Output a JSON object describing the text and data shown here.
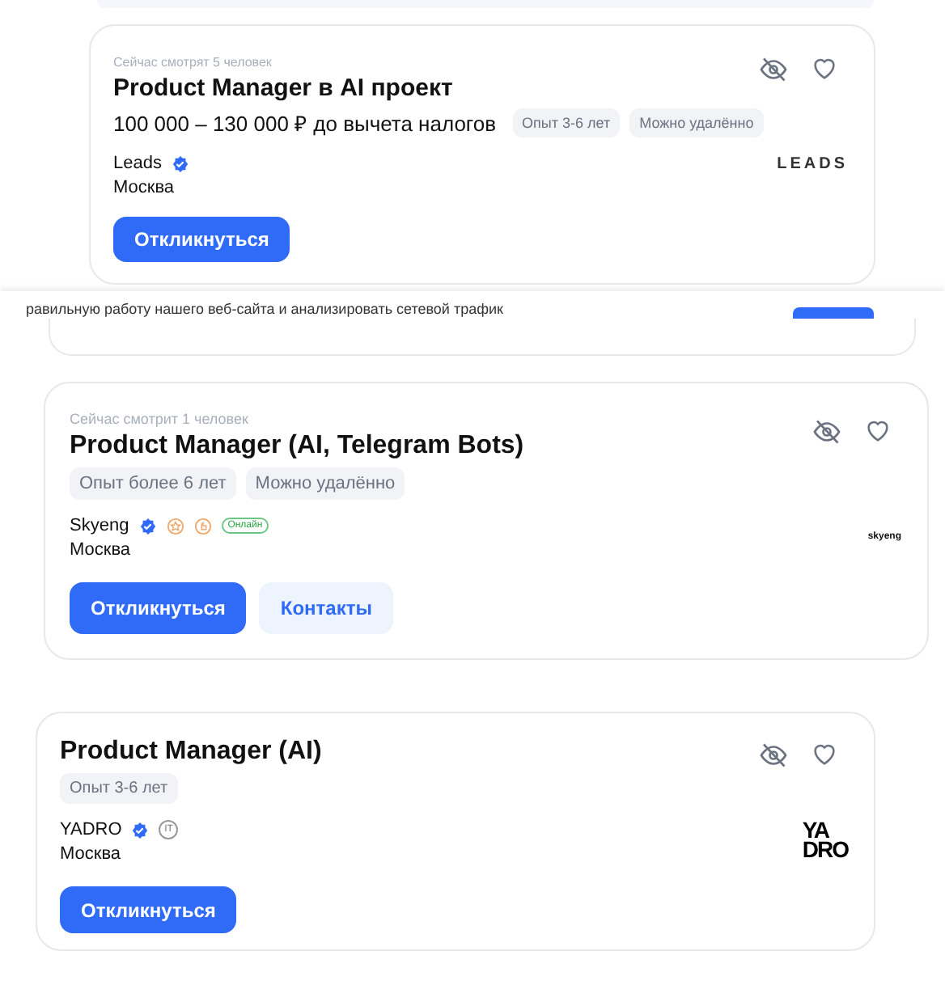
{
  "cards": [
    {
      "viewers": "Сейчас смотрят 5 человек",
      "title": "Product Manager в AI проект",
      "salary": "100 000 – 130 000 ₽ до вычета налогов",
      "tags": [
        "Опыт 3-6 лет",
        "Можно удалённо"
      ],
      "company": "Leads",
      "verified": true,
      "city": "Москва",
      "logo": {
        "kind": "wordmark",
        "lines": [
          "LEADS"
        ]
      },
      "buttons": [
        {
          "label": "Откликнуться",
          "kind": "primary"
        }
      ]
    },
    {
      "viewers": "Сейчас смотрит 1 человек",
      "title": "Product Manager (AI, Telegram Bots)",
      "tags": [
        "Опыт более 6 лет",
        "Можно удалённо"
      ],
      "company": "Skyeng",
      "verified": true,
      "badges": [
        {
          "kind": "award"
        },
        {
          "kind": "hand"
        },
        {
          "kind": "status",
          "label": "Онлайн"
        }
      ],
      "city": "Москва",
      "logo": {
        "kind": "small",
        "lines": [
          "skyeng"
        ]
      },
      "buttons": [
        {
          "label": "Откликнуться",
          "kind": "primary"
        },
        {
          "label": "Контакты",
          "kind": "secondary"
        }
      ]
    },
    {
      "title": "Product Manager (AI)",
      "tags": [
        "Опыт 3-6 лет"
      ],
      "company": "YADRO",
      "verified": true,
      "badges": [
        {
          "kind": "round",
          "label": "IT"
        }
      ],
      "city": "Москва",
      "logo": {
        "kind": "stacked",
        "lines": [
          "YA",
          "DRO"
        ]
      },
      "buttons": [
        {
          "label": "Откликнуться",
          "kind": "primary"
        }
      ]
    }
  ],
  "cookie_banner": {
    "text": "равильную работу нашего веб-сайта и анализировать сетевой трафик"
  }
}
